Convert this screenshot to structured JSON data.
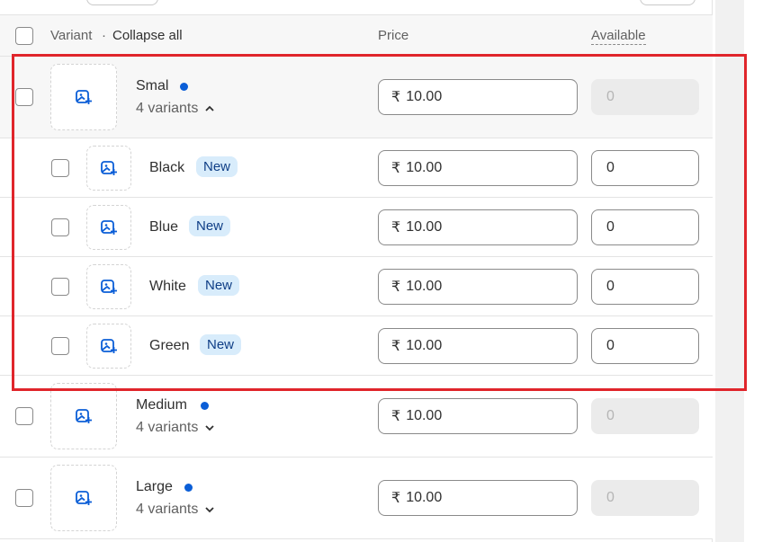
{
  "table": {
    "header": {
      "variant_label": "Variant",
      "separator": "·",
      "collapse_all": "Collapse all",
      "price_label": "Price",
      "available_label": "Available"
    },
    "groups": [
      {
        "name": "Smal",
        "variants_count": "4 variants",
        "expanded": true,
        "price_currency": "₹",
        "price": "10.00",
        "available": "0",
        "children": [
          {
            "name": "Black",
            "badge": "New",
            "price_currency": "₹",
            "price": "10.00",
            "available": "0"
          },
          {
            "name": "Blue",
            "badge": "New",
            "price_currency": "₹",
            "price": "10.00",
            "available": "0"
          },
          {
            "name": "White",
            "badge": "New",
            "price_currency": "₹",
            "price": "10.00",
            "available": "0"
          },
          {
            "name": "Green",
            "badge": "New",
            "price_currency": "₹",
            "price": "10.00",
            "available": "0"
          }
        ]
      },
      {
        "name": "Medium",
        "variants_count": "4 variants",
        "expanded": false,
        "price_currency": "₹",
        "price": "10.00",
        "available": "0"
      },
      {
        "name": "Large",
        "variants_count": "4 variants",
        "expanded": false,
        "price_currency": "₹",
        "price": "10.00",
        "available": "0"
      }
    ]
  },
  "colors": {
    "accent_dot": "#0b5ed7",
    "badge_bg": "#d8ecfb",
    "badge_text": "#0f3e86",
    "highlight_box": "#e0252b"
  },
  "icons": {
    "thumbnail": "add-image-icon",
    "expand": "chevron-down-icon",
    "collapse": "chevron-up-icon"
  }
}
